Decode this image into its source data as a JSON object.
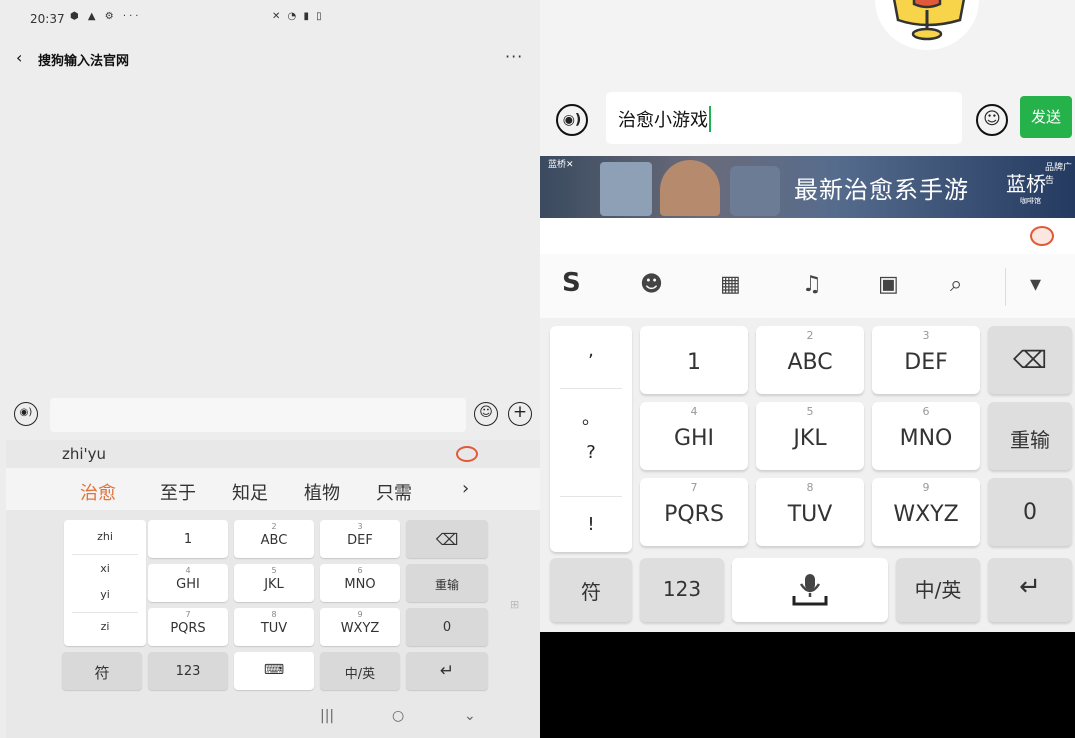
{
  "left": {
    "status_bar": {
      "time": "20:37",
      "left_icons": "⬢ ▲ ⚙ ···",
      "right_icons": "✕ ◔ ▮ ▯"
    },
    "nav": {
      "back": "‹",
      "title": "搜狗输入法官网",
      "more": "···"
    },
    "input_bar": {
      "voice": "◉)",
      "emoji": "☺",
      "plus": "+"
    },
    "ime": {
      "pinyin": "zhi'yu",
      "candidates": [
        "治愈",
        "至于",
        "知足",
        "植物",
        "只需"
      ],
      "more_candidates": "›",
      "side_keys": [
        "zhi",
        "xi",
        "yi",
        "zi"
      ],
      "keys": {
        "k1": {
          "label": "1"
        },
        "k2": {
          "num": "2",
          "label": "ABC"
        },
        "k3": {
          "num": "3",
          "label": "DEF"
        },
        "k4": {
          "num": "4",
          "label": "GHI"
        },
        "k5": {
          "num": "5",
          "label": "JKL"
        },
        "k6": {
          "num": "6",
          "label": "MNO"
        },
        "k7": {
          "num": "7",
          "label": "PQRS"
        },
        "k8": {
          "num": "8",
          "label": "TUV"
        },
        "k9": {
          "num": "9",
          "label": "WXYZ"
        },
        "k0": {
          "label": "0"
        },
        "delete": "⌫",
        "retype": "重输",
        "symbol": "符",
        "num_switch": "123",
        "space": "⌨",
        "lang": "中/英",
        "enter": "↵"
      },
      "kbd_icon": "⊞"
    },
    "sys_nav": {
      "recent": "|||",
      "home": "○",
      "back": "⌄"
    }
  },
  "right": {
    "input_bar": {
      "voice": "◉)",
      "text": "治愈小游戏",
      "emoji": "☺",
      "send": "发送"
    },
    "banner": {
      "close": "蓝桥✕",
      "text": "最新治愈系手游",
      "brand": "蓝桥",
      "brand_sub": "咖啡馆",
      "ad_tag": "品牌广告"
    },
    "toolbar": {
      "logo": "S",
      "emoji": "☻",
      "keyboard": "▦",
      "mic": "♫",
      "apps": "▣",
      "search": "⌕",
      "collapse": "▾"
    },
    "ime": {
      "side_keys": [
        ",",
        "。",
        "?",
        "!"
      ],
      "keys": {
        "k1": {
          "label": "1"
        },
        "k2": {
          "num": "2",
          "label": "ABC"
        },
        "k3": {
          "num": "3",
          "label": "DEF"
        },
        "k4": {
          "num": "4",
          "label": "GHI"
        },
        "k5": {
          "num": "5",
          "label": "JKL"
        },
        "k6": {
          "num": "6",
          "label": "MNO"
        },
        "k7": {
          "num": "7",
          "label": "PQRS"
        },
        "k8": {
          "num": "8",
          "label": "TUV"
        },
        "k9": {
          "num": "9",
          "label": "WXYZ"
        },
        "k0": {
          "label": "0"
        },
        "delete": "⌫",
        "retype": "重输",
        "symbol": "符",
        "num_switch": "123",
        "lang": "中/英",
        "enter": "↵"
      }
    }
  },
  "colors": {
    "send_green": "#25b24b",
    "candidate_highlight": "#e0733b",
    "mascot_red": "#e05a3a",
    "mascot_yellow": "#f7d44a"
  }
}
